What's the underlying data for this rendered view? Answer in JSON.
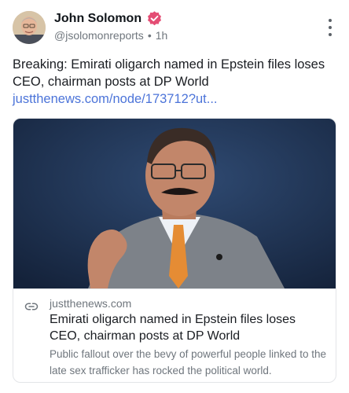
{
  "author": {
    "display_name": "John Solomon",
    "handle": "@jsolomonreports",
    "separator": "•",
    "time": "1h",
    "verified_color": "#e44d74"
  },
  "post": {
    "text": "Breaking: Emirati oligarch named in Epstein files loses CEO, chairman posts at DP World ",
    "link_text": "justthenews.com/node/173712?ut..."
  },
  "card": {
    "domain": "justthenews.com",
    "title": "Emirati oligarch named in Epstein files loses CEO, chairman posts at DP World",
    "description": "Public fallout over the bevy of powerful people linked to the late sex trafficker has rocked the political world."
  },
  "icons": {
    "more": "more-vertical-icon",
    "verified": "verified-badge-icon",
    "link": "link-icon"
  },
  "colors": {
    "link": "#4c74d9",
    "muted": "#6f767d",
    "image_background": "#1f3151"
  }
}
